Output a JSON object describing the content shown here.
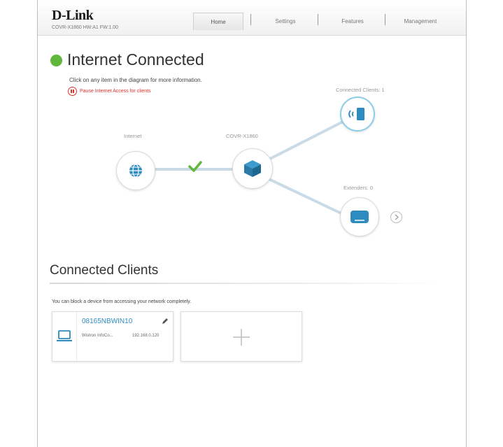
{
  "header": {
    "brand": "D-Link",
    "firmware": "COVR-X1860 HW:A1 FW:1.00",
    "tabs": [
      {
        "label": "Home",
        "active": true
      },
      {
        "label": "Settings",
        "active": false
      },
      {
        "label": "Features",
        "active": false
      },
      {
        "label": "Management",
        "active": false
      }
    ]
  },
  "status": {
    "title": "Internet Connected",
    "hint": "Click on any item in the diagram for more information.",
    "pause_label": "Pause Internet Access for clients",
    "color": "#5fb83b"
  },
  "diagram": {
    "internet_label": "Internet",
    "device_label": "COVR-X1860",
    "clients_label": "Connected Clients: 1",
    "extenders_label": "Extenders: 0",
    "link_color": "#c9dbe6",
    "accent": "#2e8bbf"
  },
  "connected_clients": {
    "title": "Connected Clients",
    "description": "You can block a device from accessing your network completely.",
    "clients": [
      {
        "name": "08165NBWIN10",
        "vendor": "Wistron InfoCo...",
        "ip": "192.168.0.120",
        "icon": "laptop-icon"
      }
    ],
    "add_icon": "plus-icon"
  }
}
